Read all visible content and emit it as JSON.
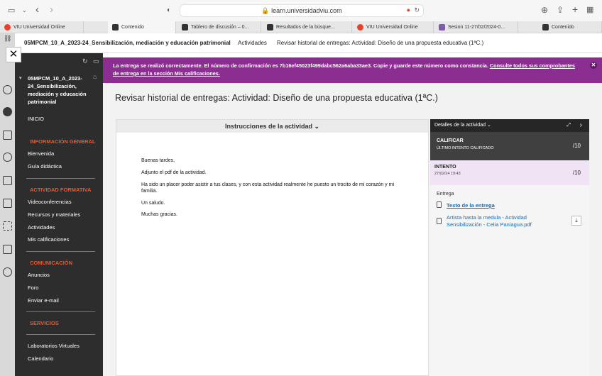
{
  "browser": {
    "url": "learn.universidadviu.com",
    "tabs": [
      {
        "label": "VIU Universidad Online",
        "color": "#e8412c"
      },
      {
        "label": "Contenido",
        "color": "#333333"
      },
      {
        "label": "Tablero de discusión – 0...",
        "color": "#333333"
      },
      {
        "label": "Resultados de la búsque...",
        "color": "#333333"
      },
      {
        "label": "VIU Universidad Online",
        "color": "#e8412c"
      },
      {
        "label": "Sesion 11-27/02/2024-0...",
        "color": "#7b5ea7"
      },
      {
        "label": "Contenido",
        "color": "#333333"
      }
    ]
  },
  "breadcrumb": {
    "course": "05MPCM_10_A_2023-24_Sensibilización, mediación y educación patrimonial",
    "section": "Actividades",
    "page": "Revisar historial de entregas: Actividad: Diseño de una propuesta educativa (1ªC.)"
  },
  "menu": {
    "course_title": "05MPCM_10_A_2023-24_Sensibilización, mediación y educación patrimonial",
    "inicio": "INICIO",
    "info_general": "INFORMACIÓN GENERAL",
    "bienvenida": "Bienvenida",
    "guia": "Guía didáctica",
    "actividad_formativa": "ACTIVIDAD FORMATIVA",
    "videoconferencias": "Videoconferencias",
    "recursos": "Recursos y materiales",
    "actividades": "Actividades",
    "calificaciones": "Mis calificaciones",
    "comunicacion": "COMUNICACIÓN",
    "anuncios": "Anuncios",
    "foro": "Foro",
    "email": "Enviar e-mail",
    "servicios": "SERVICIOS",
    "laboratorios": "Laboratorios Virtuales",
    "calendario": "Calendario"
  },
  "banner": {
    "text": "La entrega se realizó correctamente. El número de confirmación es 7b16ef45023f499dabc562a6aba33ae3. Copie y guarde este número como constancia.",
    "link": "Consulte todos sus comprobantes de entrega en la sección Mis calificaciones."
  },
  "page_title": "Revisar historial de entregas: Actividad: Diseño de una propuesta educativa (1ªC.)",
  "instructions_header": "Instrucciones de la actividad",
  "submission_text": [
    "Buenas tardes,",
    "Adjunto el pdf de la actividad.",
    "Ha sido un placer poder asistir a tus clases, y con esta actividad realmente he puesto un trocito de mi corazón y mi familia.",
    "Un saludo.",
    "Muchas gracias."
  ],
  "details": {
    "header": "Detalles de la actividad",
    "calificar": "CALIFICAR",
    "ultimo": "ÚLTIMO INTENTO CALIFICADO",
    "calificar_score": "/10",
    "intento": "INTENTO",
    "intento_date": "27/02/24 19:43",
    "intento_score": "/10",
    "entrega_label": "Entrega",
    "texto_link": "Texto de la entrega",
    "file_link": "Artista hasta la medula - Actividad Sensibilización - Celia Paniagua.pdf"
  },
  "colors": {
    "menu_bg": "#2d2d2d",
    "accent": "#e8582c",
    "banner": "#8c2d92"
  }
}
